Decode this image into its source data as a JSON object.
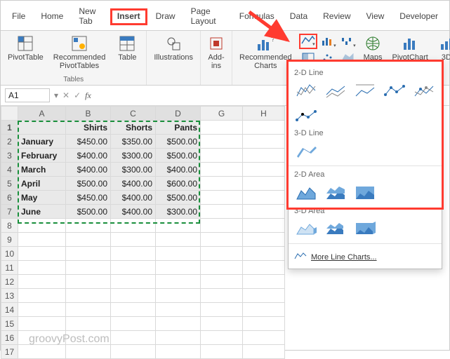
{
  "tabs": {
    "file": "File",
    "home": "Home",
    "newtab": "New Tab",
    "insert": "Insert",
    "draw": "Draw",
    "pagelayout": "Page Layout",
    "formulas": "Formulas",
    "data": "Data",
    "review": "Review",
    "view": "View",
    "developer": "Developer"
  },
  "ribbon": {
    "pivottable": "PivotTable",
    "recpivot": "Recommended\nPivotTables",
    "table": "Table",
    "group_tables": "Tables",
    "illustrations": "Illustrations",
    "addins": "Add-\nins",
    "reccharts": "Recommended\nCharts",
    "maps": "Maps",
    "pivotchart": "PivotChart",
    "threeD": "3D"
  },
  "namebox": "A1",
  "columns": [
    "A",
    "B",
    "C",
    "D",
    "G",
    "H"
  ],
  "headers": {
    "b": "Shirts",
    "c": "Shorts",
    "d": "Pants"
  },
  "rows": [
    {
      "n": "1"
    },
    {
      "n": "2",
      "a": "January",
      "b": "$450.00",
      "c": "$350.00",
      "d": "$500.00"
    },
    {
      "n": "3",
      "a": "February",
      "b": "$400.00",
      "c": "$300.00",
      "d": "$500.00"
    },
    {
      "n": "4",
      "a": "March",
      "b": "$400.00",
      "c": "$300.00",
      "d": "$400.00"
    },
    {
      "n": "5",
      "a": "April",
      "b": "$500.00",
      "c": "$400.00",
      "d": "$600.00"
    },
    {
      "n": "6",
      "a": "May",
      "b": "$450.00",
      "c": "$400.00",
      "d": "$500.00"
    },
    {
      "n": "7",
      "a": "June",
      "b": "$500.00",
      "c": "$400.00",
      "d": "$300.00"
    },
    {
      "n": "8"
    },
    {
      "n": "9"
    },
    {
      "n": "10"
    },
    {
      "n": "11"
    },
    {
      "n": "12"
    },
    {
      "n": "13"
    },
    {
      "n": "14"
    },
    {
      "n": "15"
    },
    {
      "n": "16"
    },
    {
      "n": "17"
    }
  ],
  "panel": {
    "s1": "2-D Line",
    "s2": "3-D Line",
    "s3": "2-D Area",
    "s4": "3-D Area",
    "more": "More Line Charts..."
  },
  "watermark": "groovyPost.com",
  "chart_data": {
    "type": "table",
    "categories": [
      "January",
      "February",
      "March",
      "April",
      "May",
      "June"
    ],
    "series": [
      {
        "name": "Shirts",
        "values": [
          450,
          400,
          400,
          500,
          450,
          500
        ]
      },
      {
        "name": "Shorts",
        "values": [
          350,
          300,
          300,
          400,
          400,
          400
        ]
      },
      {
        "name": "Pants",
        "values": [
          500,
          500,
          400,
          600,
          500,
          300
        ]
      }
    ],
    "title": "",
    "xlabel": "",
    "ylabel": ""
  }
}
